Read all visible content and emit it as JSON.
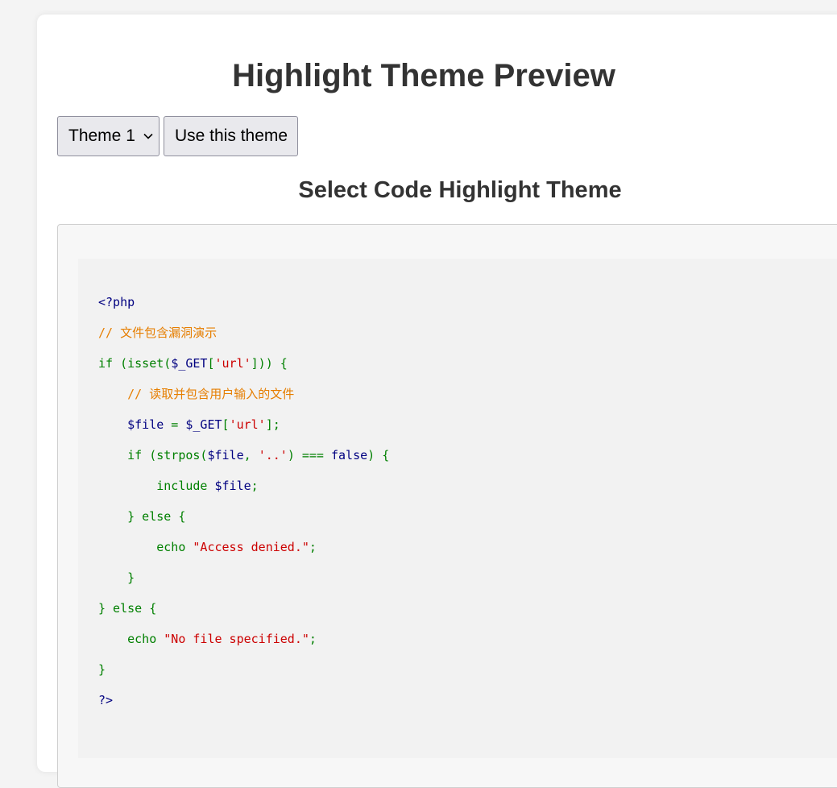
{
  "page": {
    "title": "Highlight Theme Preview",
    "subtitle": "Select Code Highlight Theme"
  },
  "controls": {
    "theme_select_value": "Theme 1",
    "apply_button_label": "Use this theme"
  },
  "code": {
    "open_tag": "<?php",
    "comment_1": "// 文件包含漏洞演示",
    "l3_a": "if (isset(",
    "l3_var": "$_GET",
    "l3_b": "[",
    "l3_str": "'url'",
    "l3_c": "])) {",
    "indent_1": "    ",
    "indent_2": "        ",
    "comment_2": "// 读取并包含用户输入的文件",
    "l5_var1": "$file",
    "l5_eq": " = ",
    "l5_var2": "$_GET",
    "l5_b": "[",
    "l5_str": "'url'",
    "l5_c": "];",
    "l6_a": "if (strpos(",
    "l6_var": "$file",
    "l6_b": ", ",
    "l6_str": "'..'",
    "l6_c": ") === ",
    "l6_bool": "false",
    "l6_d": ") {",
    "l7_kw": "include ",
    "l7_var": "$file",
    "l7_end": ";",
    "l8": "} else {",
    "l9_kw": "echo ",
    "l9_str": "\"Access denied.\"",
    "l9_end": ";",
    "l10": "}",
    "l11": "} else {",
    "l12_kw": "echo ",
    "l12_str": "\"No file specified.\"",
    "l12_end": ";",
    "l13": "}",
    "close_tag": "?>"
  },
  "colors": {
    "keyword": "#008000",
    "variable": "#000080",
    "string": "#cc0000",
    "comment": "#e67e00",
    "heading": "#333333"
  }
}
